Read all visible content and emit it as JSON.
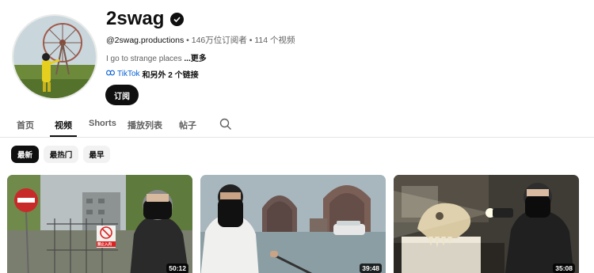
{
  "channel": {
    "name": "2swag",
    "handle": "@2swag.productions",
    "subscribers": "146万位订阅者",
    "videos": "114 个视频",
    "separator": "•",
    "description": "I go to strange places",
    "more_label": "...更多",
    "link_main": "TikTok",
    "link_extra": "和另外 2 个链接",
    "subscribe_label": "订阅"
  },
  "tabs": [
    {
      "label": "首页",
      "active": false
    },
    {
      "label": "视频",
      "active": true
    },
    {
      "label": "Shorts",
      "active": false
    },
    {
      "label": "播放列表",
      "active": false
    },
    {
      "label": "帖子",
      "active": false
    }
  ],
  "filters": [
    {
      "label": "最新",
      "active": true
    },
    {
      "label": "最热门",
      "active": false
    },
    {
      "label": "最早",
      "active": false
    }
  ],
  "videos": [
    {
      "duration": "50:12",
      "sign_text": "禁止入内",
      "thumb": "abandoned-gate"
    },
    {
      "duration": "39:48",
      "thumb": "flooded-houses"
    },
    {
      "duration": "35:08",
      "thumb": "skull-flashlight"
    }
  ],
  "colors": {
    "text": "#0f0f0f",
    "secondary": "#606060",
    "link": "#065fd4",
    "chip_bg": "#f2f2f2"
  },
  "icons": [
    "verified-icon",
    "link-icon",
    "search-icon"
  ]
}
